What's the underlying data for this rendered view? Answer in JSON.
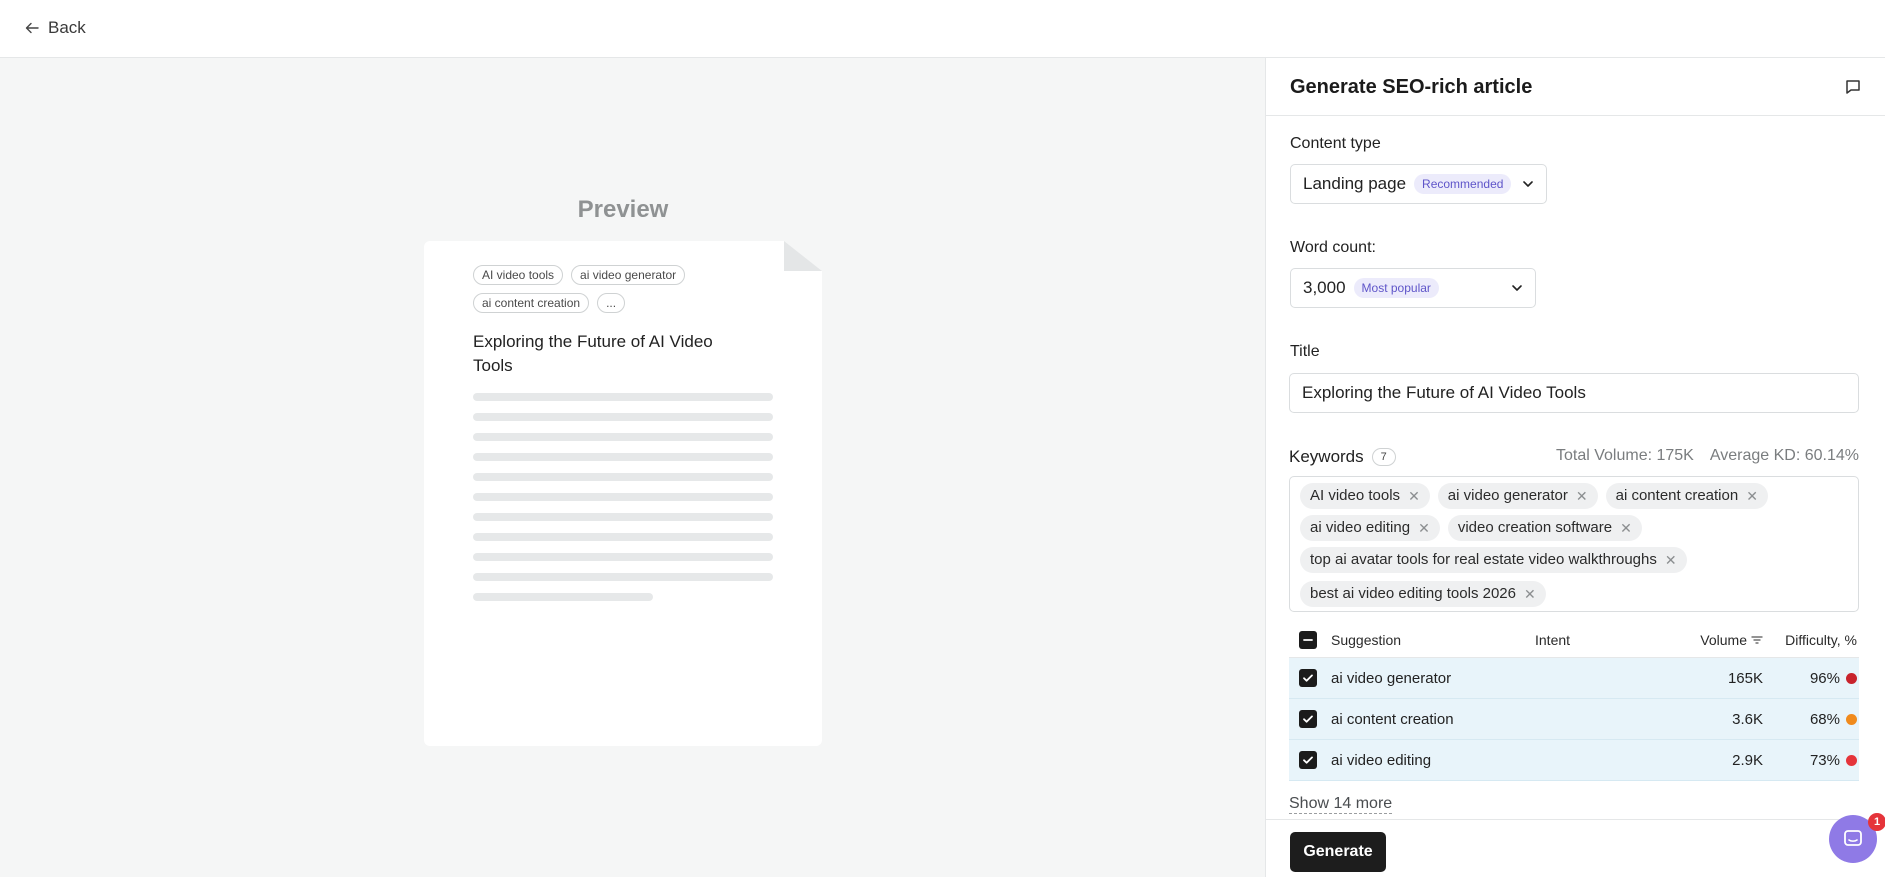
{
  "topbar": {
    "back_label": "Back"
  },
  "preview": {
    "title": "Preview",
    "tags": [
      "AI video tools",
      "ai video generator",
      "ai content creation",
      "..."
    ],
    "heading": "Exploring the Future of AI Video Tools"
  },
  "panel": {
    "title": "Generate SEO-rich article",
    "content_type": {
      "label": "Content type",
      "value": "Landing page",
      "badge": "Recommended"
    },
    "word_count": {
      "label": "Word count:",
      "value": "3,000",
      "badge": "Most popular"
    },
    "title_field": {
      "label": "Title",
      "value": "Exploring the Future of AI Video Tools"
    },
    "keywords": {
      "label": "Keywords",
      "count": "7",
      "total_volume": "Total Volume: 175K",
      "average_kd": "Average KD: 60.14%",
      "chips": [
        "AI video tools",
        "ai video generator",
        "ai content creation",
        "ai video editing",
        "video creation software",
        "top ai avatar tools for real estate video walkthroughs",
        "best ai video editing tools 2026"
      ]
    },
    "table": {
      "headers": {
        "suggestion": "Suggestion",
        "intent": "Intent",
        "volume": "Volume",
        "difficulty": "Difficulty, %"
      },
      "rows": [
        {
          "suggestion": "ai video generator",
          "intent": "",
          "volume": "165K",
          "difficulty": "96%",
          "color": "#c8232c"
        },
        {
          "suggestion": "ai content creation",
          "intent": "",
          "volume": "3.6K",
          "difficulty": "68%",
          "color": "#f08a1c"
        },
        {
          "suggestion": "ai video editing",
          "intent": "",
          "volume": "2.9K",
          "difficulty": "73%",
          "color": "#e5343a"
        }
      ]
    },
    "show_more": "Show 14 more",
    "generate_label": "Generate"
  },
  "chat": {
    "badge": "1"
  },
  "colors": {
    "accent_purple": "#5f55c9",
    "row_highlight": "#e8f4fa",
    "button_dark": "#1d1d1d"
  }
}
